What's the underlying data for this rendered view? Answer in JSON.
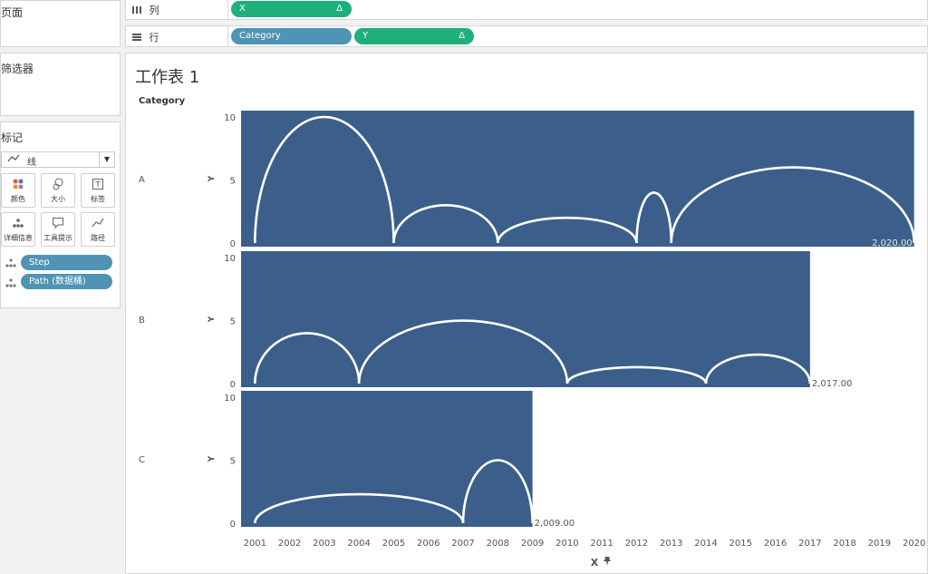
{
  "left_panel": {
    "pages_title": "页面",
    "filters_title": "筛选器",
    "marks_title": "标记",
    "mark_type": "线",
    "buttons": [
      {
        "label": "颜色",
        "icon": "color-dots-icon"
      },
      {
        "label": "大小",
        "icon": "size-icon"
      },
      {
        "label": "标签",
        "icon": "label-icon"
      },
      {
        "label": "详细信息",
        "icon": "detail-icon"
      },
      {
        "label": "工具提示",
        "icon": "tooltip-icon"
      },
      {
        "label": "路径",
        "icon": "path-icon"
      }
    ],
    "fields": [
      "Step",
      "Path (数据桶)"
    ]
  },
  "shelves": {
    "columns_label": "列",
    "rows_label": "行",
    "columns_pills": [
      {
        "label": "X",
        "delta": "Δ"
      }
    ],
    "rows_pills": [
      {
        "label": "Category"
      },
      {
        "label": "Y",
        "delta": "Δ"
      }
    ]
  },
  "sheet": {
    "title": "工作表 1",
    "category_header": "Category",
    "x_axis_label": "X",
    "pin_icon": "pin-icon"
  },
  "colors": {
    "fill": "#3b5f8a",
    "arc": "#ffffff",
    "green_pill": "#1faf7a",
    "blue_pill": "#4f93b5"
  },
  "chart_data": {
    "type": "line",
    "x_ticks": [
      2001,
      2002,
      2003,
      2004,
      2005,
      2006,
      2007,
      2008,
      2009,
      2010,
      2011,
      2012,
      2013,
      2014,
      2015,
      2016,
      2017,
      2018,
      2019,
      2020
    ],
    "xlim": [
      2000.6,
      2020.4
    ],
    "x_label": "X",
    "y_ticks": [
      0,
      5,
      10
    ],
    "ylim": [
      0,
      10
    ],
    "y_label": "Y",
    "grid": false,
    "panels": [
      {
        "category": "A",
        "x_end": 2020,
        "end_label": "2,020.00",
        "arcs": [
          {
            "start": 2001,
            "end": 2005,
            "height": 10
          },
          {
            "start": 2005,
            "end": 2008,
            "height": 3
          },
          {
            "start": 2008,
            "end": 2012,
            "height": 2
          },
          {
            "start": 2012,
            "end": 2013,
            "height": 4
          },
          {
            "start": 2013,
            "end": 2020,
            "height": 6
          }
        ]
      },
      {
        "category": "B",
        "x_end": 2017,
        "end_label": "2,017.00",
        "arcs": [
          {
            "start": 2001,
            "end": 2004,
            "height": 4
          },
          {
            "start": 2004,
            "end": 2010,
            "height": 5
          },
          {
            "start": 2010,
            "end": 2014,
            "height": 1.3
          },
          {
            "start": 2014,
            "end": 2017,
            "height": 2.3
          }
        ]
      },
      {
        "category": "C",
        "x_end": 2009,
        "end_label": "2,009.00",
        "arcs": [
          {
            "start": 2001,
            "end": 2007,
            "height": 2.3
          },
          {
            "start": 2007,
            "end": 2009,
            "height": 5
          }
        ]
      }
    ]
  }
}
